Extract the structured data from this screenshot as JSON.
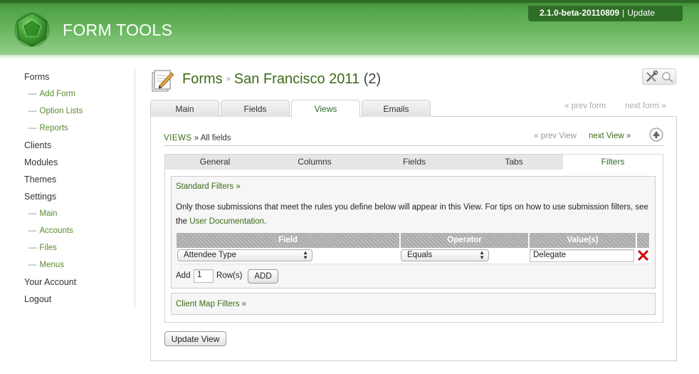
{
  "app": {
    "name": "FORM TOOLS",
    "version": "2.1.0-beta-20110809",
    "version_separator": "|",
    "update_label": "Update"
  },
  "nav": {
    "forms": "Forms",
    "add_form": "Add Form",
    "option_lists": "Option Lists",
    "reports": "Reports",
    "clients": "Clients",
    "modules": "Modules",
    "themes": "Themes",
    "settings": "Settings",
    "settings_main": "Main",
    "accounts": "Accounts",
    "files": "Files",
    "menus": "Menus",
    "your_account": "Your Account",
    "logout": "Logout",
    "sub_dash": "—"
  },
  "page": {
    "breadcrumb_root": "Forms",
    "breadcrumb_sep": "»",
    "form_name": "San Francisco 2011",
    "form_id": "(2)"
  },
  "main_tabs": [
    "Main",
    "Fields",
    "Views",
    "Emails"
  ],
  "main_tab_active": "Views",
  "form_nav": {
    "prev": "« prev form",
    "next": "next form »"
  },
  "views_header": {
    "views_link": "VIEWS",
    "sep": "»",
    "current": "All fields",
    "prev": "« prev View",
    "next": "next View »"
  },
  "sub_tabs": [
    "General",
    "Columns",
    "Fields",
    "Tabs",
    "Filters"
  ],
  "sub_tab_active": "Filters",
  "filters": {
    "standard_title": "Standard Filters »",
    "description_before": "Only those submissions that meet the rules you define below will appear in this View. For tips on how to use submission filters, see the",
    "doc_link": "User Documentation",
    "description_after": ".",
    "columns": {
      "field": "Field",
      "operator": "Operator",
      "values": "Value(s)"
    },
    "rows": [
      {
        "field": "Attendee Type",
        "operator": "Equals",
        "value": "Delegate"
      }
    ],
    "add_label": "Add",
    "add_count": "1",
    "rows_label": "Row(s)",
    "add_button": "ADD",
    "client_map_title": "Client Map Filters »"
  },
  "update_button": "Update View",
  "colors": {
    "brand_green": "#4fa146",
    "link_green": "#3d6b18",
    "delete_red": "#cc1111"
  }
}
